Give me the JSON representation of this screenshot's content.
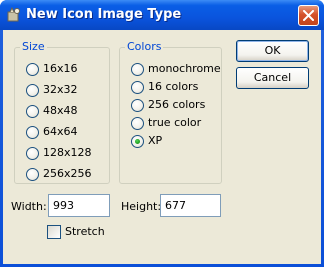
{
  "window": {
    "title": "New Icon Image Type"
  },
  "size_group": {
    "legend": "Size",
    "options": [
      "16x16",
      "32x32",
      "48x48",
      "64x64",
      "128x128",
      "256x256"
    ],
    "selected": null
  },
  "colors_group": {
    "legend": "Colors",
    "options": [
      "monochrome",
      "16 colors",
      "256 colors",
      "true color",
      "XP"
    ],
    "selected": "XP"
  },
  "buttons": {
    "ok": "OK",
    "cancel": "Cancel"
  },
  "width_field": {
    "label": "Width:",
    "value": "993"
  },
  "height_field": {
    "label": "Height:",
    "value": "677"
  },
  "stretch": {
    "label": "Stretch",
    "checked": false
  },
  "colors": {
    "title_bar": "#0a54dd",
    "close_button": "#d5512a",
    "group_legend": "#0046d5",
    "dialog_bg": "#ece9d8"
  }
}
